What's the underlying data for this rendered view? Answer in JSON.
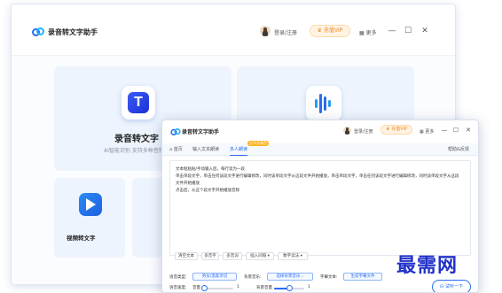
{
  "back_window": {
    "app_title": "录音转文字助手",
    "login_label": "登录/注册",
    "vip_label": "充值VIP",
    "more_label": "更多",
    "controls": {
      "menu": "≡",
      "minimize": "—",
      "maximize": "☐",
      "close": "✕"
    },
    "cards": [
      {
        "title": "录音转文字",
        "subtitle": "AI智能识别 支持多种音频"
      },
      {
        "title": "视频转文字"
      }
    ]
  },
  "front_window": {
    "app_title": "录音转文字助手",
    "login_label": "登录/注册",
    "vip_label": "充值VIP",
    "more_label": "更多",
    "controls": {
      "menu": "≡",
      "minimize": "—",
      "maximize": "☐",
      "close": "✕"
    },
    "tabs": [
      {
        "label": "首页"
      },
      {
        "label": "输入文本朗读"
      },
      {
        "label": "多人朗读",
        "badge": "支持多角色"
      }
    ],
    "help_label": "帮助&反馈",
    "text_lines": [
      "文本框粘贴/手动输入后，每行读为一段",
      "单击单段文字，单击任何该段文字进行编辑修改，同时该单段文字从这段文件开始播放，单击单段文字，单击任何该段文字进行编辑修改，同时该单段文字从这段",
      "文件开始播放",
      "点击后，从这个段文字开始播放音频"
    ],
    "tool_buttons": [
      "清空文本",
      "多音字",
      "多音词",
      "插入间隔 ▾",
      "数字读法 ▾"
    ],
    "options": {
      "voice_label": "语音类型:",
      "voice_value": "男女/温柔亲切",
      "bgm_label": "背景音乐:",
      "bgm_value": "选择背景音乐...",
      "subtitle_label": "字幕文本:",
      "subtitle_value": "生成字幕文件",
      "speed_label": "语音速度:",
      "volume_label": "音量",
      "volume_value": "1",
      "bg_volume_label": "背景音量",
      "bg_volume_value": "1",
      "speed_level": 0.05,
      "bg_volume_level": 0.5
    },
    "generate_label": "试听一下"
  },
  "watermark": "最需网"
}
